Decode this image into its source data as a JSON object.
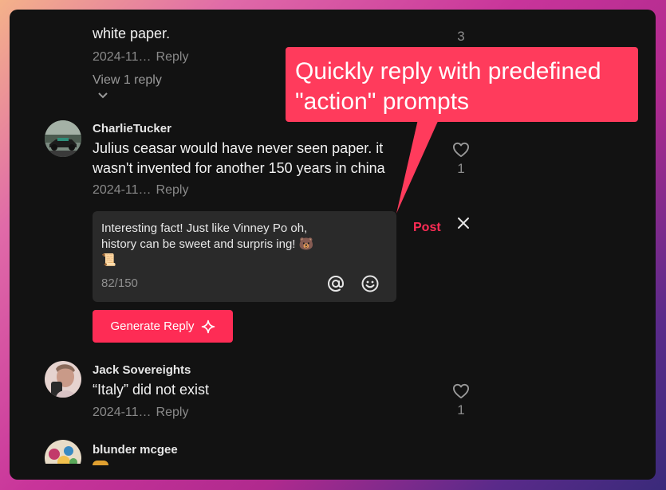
{
  "comments": [
    {
      "text": "white paper.",
      "date": "2024-11…",
      "reply_label": "Reply",
      "view_replies": "View 1 reply",
      "likes": "3"
    },
    {
      "username": "CharlieTucker",
      "text": "Julius ceasar would have never seen paper. it wasn't invented for another 150 years in china",
      "date": "2024-11…",
      "reply_label": "Reply",
      "likes": "1"
    },
    {
      "username": "Jack Sovereights",
      "text": "“Italy” did not exist",
      "date": "2024-11…",
      "reply_label": "Reply",
      "likes": "1"
    },
    {
      "username": "blunder mcgee"
    }
  ],
  "reply_box": {
    "text": "Interesting fact! Just like Vinney Po oh, history can be sweet and surpris ing! 🐻📜",
    "counter": "82/150",
    "post_label": "Post",
    "generate_label": "Generate Reply"
  },
  "callout": {
    "text": "Quickly reply with predefined \"action\" prompts"
  },
  "colors": {
    "accent": "#fe2c55",
    "callout": "#ff3b5c",
    "panel": "#121212"
  }
}
